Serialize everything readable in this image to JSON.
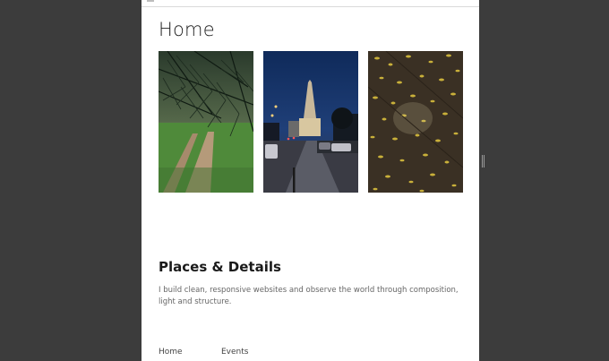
{
  "page": {
    "title": "Home"
  },
  "gallery": {
    "photos": [
      {
        "icon": "pine-branch-forest-path-photo"
      },
      {
        "icon": "church-street-night-photo"
      },
      {
        "icon": "wet-leaves-pavement-photo"
      }
    ]
  },
  "section": {
    "heading": "Places & Details",
    "text": "I build clean, responsive websites and observe the world through composition, light and structure."
  },
  "footer": {
    "links": [
      "Home",
      "Events"
    ]
  },
  "colors": {
    "window_background": "#3c3c3c",
    "page_background": "#ffffff"
  }
}
